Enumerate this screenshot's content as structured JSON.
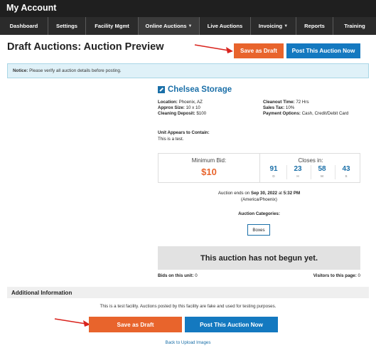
{
  "header": {
    "title": "My Account"
  },
  "nav": [
    {
      "label": "Dashboard",
      "dropdown": false,
      "active": false
    },
    {
      "label": "Settings",
      "dropdown": false,
      "active": false
    },
    {
      "label": "Facility Mgmt",
      "dropdown": false,
      "active": false
    },
    {
      "label": "Online Auctions",
      "dropdown": true,
      "active": true
    },
    {
      "label": "Live Auctions",
      "dropdown": false,
      "active": false
    },
    {
      "label": "Invoicing",
      "dropdown": true,
      "active": false
    },
    {
      "label": "Reports",
      "dropdown": false,
      "active": false
    },
    {
      "label": "Training",
      "dropdown": false,
      "active": false
    }
  ],
  "page": {
    "title": "Draft Auctions: Auction Preview"
  },
  "actions": {
    "save_draft": "Save as Draft",
    "post_now": "Post This Auction Now"
  },
  "notice": {
    "label": "Notice:",
    "text": "Please verify all auction details before posting."
  },
  "facility": {
    "name": "Chelsea Storage"
  },
  "details": {
    "location_label": "Location:",
    "location": "Phoenix, AZ",
    "size_label": "Approx Size:",
    "size": "10 x 10",
    "deposit_label": "Cleaning Deposit:",
    "deposit": "$100",
    "cleanout_label": "Cleanout Time:",
    "cleanout": "72 Hrs",
    "tax_label": "Sales Tax:",
    "tax": "10%",
    "payment_label": "Payment Options:",
    "payment": "Cash, Credit/Debit Card"
  },
  "contents": {
    "label": "Unit Appears to Contain:",
    "text": "This is a test."
  },
  "bid": {
    "min_label": "Minimum Bid:",
    "min_value": "$10"
  },
  "countdown": {
    "label": "Closes in:",
    "days": "91",
    "days_unit": "D",
    "hours": "23",
    "hours_unit": "H",
    "minutes": "58",
    "minutes_unit": "M",
    "seconds": "43",
    "seconds_unit": "S"
  },
  "end": {
    "prefix": "Auction ends on",
    "date": "Sep 30, 2022",
    "at": "at",
    "time": "5:32 PM",
    "timezone": "(America/Phoenix)"
  },
  "categories": {
    "label": "Auction Categories:",
    "items": [
      "Boxes"
    ]
  },
  "status": {
    "message": "This auction has not begun yet."
  },
  "stats": {
    "bids_label": "Bids on this unit:",
    "bids": "0",
    "visitors_label": "Visitors to this page:",
    "visitors": "0"
  },
  "additional": {
    "title": "Additional Information",
    "text": "This is a test facility. Auctions posted by this facility are fake and used for testing purposes."
  },
  "back_link": "Back to Upload Images",
  "colors": {
    "draft": "#e8642c",
    "post": "#1479c0",
    "arrow": "#d9231d",
    "link": "#1a6fa8"
  }
}
